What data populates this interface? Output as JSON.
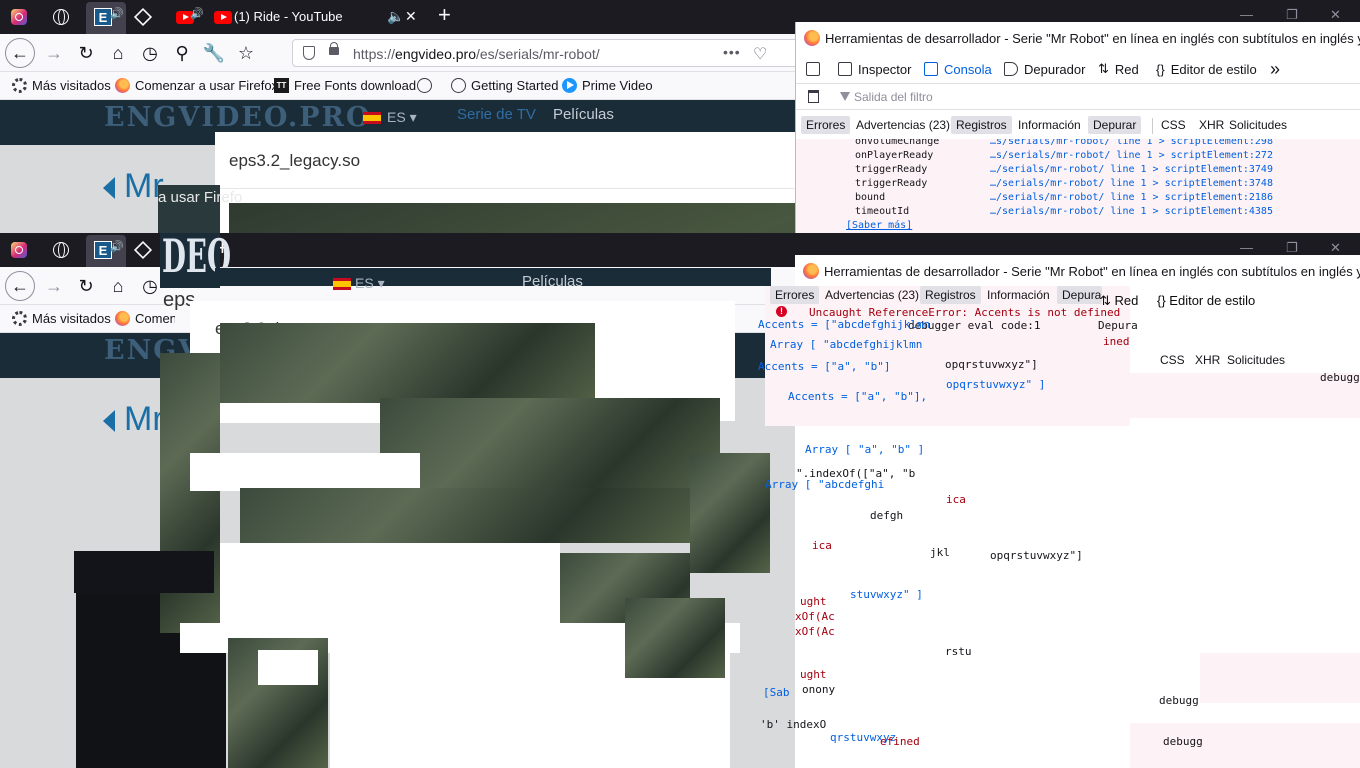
{
  "browser": {
    "tabs": [
      {
        "icon": "instagram-icon"
      },
      {
        "icon": "globe-icon"
      },
      {
        "icon": "engvideo-icon",
        "audio": "speaker-icon"
      },
      {
        "icon": "cube-icon"
      },
      {
        "icon": "youtube-icon",
        "audio": "speaker-icon"
      }
    ],
    "active_tab_title": "(1) Ride - YouTube",
    "mute_glyph": "🔈",
    "close_tab_glyph": "✕",
    "new_tab_glyph": "+",
    "url_prefix": "https://",
    "url_host": "engvideo.pro",
    "url_path": "/es/serials/mr-robot/",
    "url_actions": [
      "•••",
      "♡"
    ]
  },
  "bookmarks": [
    {
      "icon": "gear-icon",
      "label": "Más visitados"
    },
    {
      "icon": "firefox-icon",
      "label": "Comenzar a usar Firefox"
    },
    {
      "icon": "fonts-icon",
      "label": "Free Fonts download"
    },
    {
      "icon": "globe-icon",
      "label": ""
    },
    {
      "icon": "globe-icon",
      "label": "Getting Started"
    },
    {
      "icon": "prime-video-icon",
      "label": "Prime Video"
    }
  ],
  "site": {
    "logo": "ENGVIDEO.PRO",
    "lang": "ES ▾",
    "nav_tv": "Serie de TV",
    "nav_films": "Películas",
    "page_title": "Mr",
    "video_title": "eps3.2_legacy.so",
    "overlay_text": "a usar Firefo",
    "glitch_logo": "DEO",
    "glitch_short": "eps"
  },
  "devtools": {
    "window_title": "Herramientas de desarrollador - Serie \"Mr Robot\" en línea en inglés con subtítulos en inglés y es...",
    "tabs": [
      "Inspector",
      "Consola",
      "Depurador",
      "Red",
      "Editor de estilo"
    ],
    "overflow": "»",
    "filter_placeholder": "Salida del filtro",
    "levels": [
      "Errores",
      "Advertencias (23)",
      "Registros",
      "Información",
      "Depurar",
      "CSS",
      "XHR",
      "Solicitudes"
    ],
    "console_rows": [
      {
        "key": "onVolumeChange",
        "src": "…s/serials/mr-robot/ line 1 > scriptElement:298"
      },
      {
        "key": "onPlayerReady",
        "src": "…s/serials/mr-robot/ line 1 > scriptElement:272"
      },
      {
        "key": "triggerReady",
        "src": "…/serials/mr-robot/ line 1 > scriptElement:3749"
      },
      {
        "key": "triggerReady",
        "src": "…/serials/mr-robot/ line 1 > scriptElement:3748"
      },
      {
        "key": "bound",
        "src": "…/serials/mr-robot/ line 1 > scriptElement:2186"
      },
      {
        "key": "timeoutId",
        "src": "…/serials/mr-robot/ line 1 > scriptElement:4385"
      }
    ],
    "learn_more": "[Saber más]"
  },
  "glitch_console": {
    "error": "Uncaught ReferenceError: Accents is not defined",
    "debugger_eval": "debugger eval code:1",
    "line1": "Accents = [\"abcdefghijklmn",
    "line2": "Array [ \"abcdefghijklmn",
    "line3": "Accents = [\"a\", \"b\"]",
    "line4": "Array [ \"a\", \"b\" ]",
    "line5": "Accents = [\"a\", \"b\"],",
    "line6": "\".indexOf([\"a\", \"b",
    "line7": "Array [ \"abcdefghi",
    "line8": "opqrstuvwxyz\"]",
    "line9": "opqrstuvwxyz\" ]",
    "line10": "jkl",
    "line11": "opqrstuvwxyz\"]",
    "line12": "stuvwxyz\" ]",
    "line13": "ught",
    "line14": "xOf(Ac",
    "line15": "qrstuvwxyz",
    "line16": "efined",
    "line17": "[Sab",
    "line18": "debugg",
    "line19": "debugger",
    "line20": "ined",
    "line21": "Depura",
    "line22": "ica",
    "line23": "defgh",
    "line24": "rstu",
    "line25": "onony",
    "line26": "'b' indexO"
  }
}
